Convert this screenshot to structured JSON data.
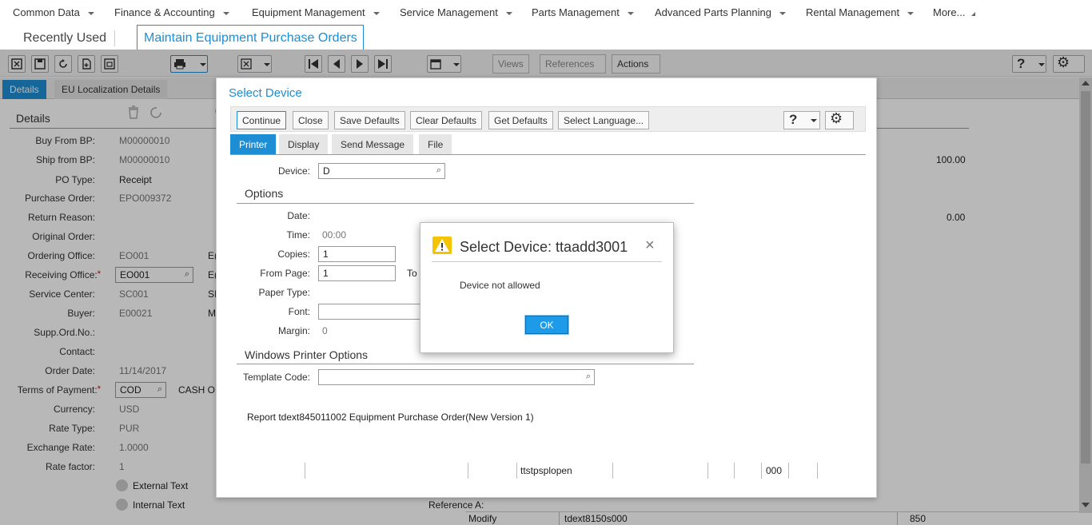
{
  "menu": {
    "items": [
      "Common Data",
      "Finance & Accounting",
      "Equipment Management",
      "Service Management",
      "Parts Management",
      "Advanced Parts Planning",
      "Rental Management"
    ],
    "more": "More..."
  },
  "tabs": {
    "recently_used": "Recently Used",
    "active": "Maintain Equipment Purchase Orders"
  },
  "toolbar": {
    "views": "Views",
    "references": "References",
    "actions": "Actions"
  },
  "main_tabs": [
    "Details",
    "EU Localization Details"
  ],
  "details": {
    "section_title": "Details",
    "fields": {
      "buy_from_bp_label": "Buy From BP:",
      "buy_from_bp": "M00000010",
      "ship_from_bp_label": "Ship from BP:",
      "ship_from_bp": "M00000010",
      "po_type_label": "PO Type:",
      "po_type": "Receipt",
      "purchase_order_label": "Purchase Order:",
      "purchase_order": "EPO009372",
      "return_reason_label": "Return Reason:",
      "original_order_label": "Original Order:",
      "ordering_office_label": "Ordering Office:",
      "ordering_office": "EO001",
      "ordering_office_desc": "E(",
      "receiving_office_label": "Receiving Office:",
      "receiving_office": "EO001",
      "receiving_office_desc": "E(",
      "service_center_label": "Service Center:",
      "service_center": "SC001",
      "service_center_desc": "SI",
      "buyer_label": "Buyer:",
      "buyer": "E00021",
      "buyer_desc": "M",
      "supp_ord_no_label": "Supp.Ord.No.:",
      "contact_label": "Contact:",
      "order_date_label": "Order Date:",
      "order_date": "11/14/2017",
      "terms_of_payment_label": "Terms of Payment:",
      "terms_of_payment": "COD",
      "terms_of_payment_desc": "CASH OI",
      "currency_label": "Currency:",
      "currency": "USD",
      "rate_type_label": "Rate Type:",
      "rate_type": "PUR",
      "exchange_rate_label": "Exchange Rate:",
      "exchange_rate": "1.0000",
      "rate_factor_label": "Rate factor:",
      "rate_factor": "1",
      "external_text": "External Text",
      "internal_text": "Internal Text",
      "right_value_1": "100.00",
      "right_value_2": "0.00",
      "reference_a_label": "Reference A:"
    }
  },
  "select_device": {
    "title": "Select Device",
    "buttons": [
      "Continue",
      "Close",
      "Save Defaults",
      "Clear Defaults",
      "Get Defaults",
      "Select Language..."
    ],
    "tabs": [
      "Printer",
      "Display",
      "Send Message",
      "File"
    ],
    "device_label": "Device:",
    "device_value": "D",
    "options_title": "Options",
    "date_label": "Date:",
    "time_label": "Time:",
    "time_value": "00:00",
    "copies_label": "Copies:",
    "copies_value": "1",
    "from_page_label": "From Page:",
    "from_page_value": "1",
    "to_label": "To",
    "paper_type_label": "Paper Type:",
    "font_label": "Font:",
    "margin_label": "Margin:",
    "margin_value": "0",
    "windows_printer_title": "Windows Printer Options",
    "template_code_label": "Template Code:",
    "report_text": "Report tdext845011002 Equipment Purchase Order(New Version 1)",
    "status_cells": {
      "program": "ttstpsplopen",
      "code": "000"
    }
  },
  "bottom_bar": {
    "mode": "Modify",
    "session": "tdext8150s000",
    "number": "850"
  },
  "alert": {
    "title": "Select Device: ttaadd3001",
    "message": "Device not allowed",
    "ok": "OK"
  }
}
